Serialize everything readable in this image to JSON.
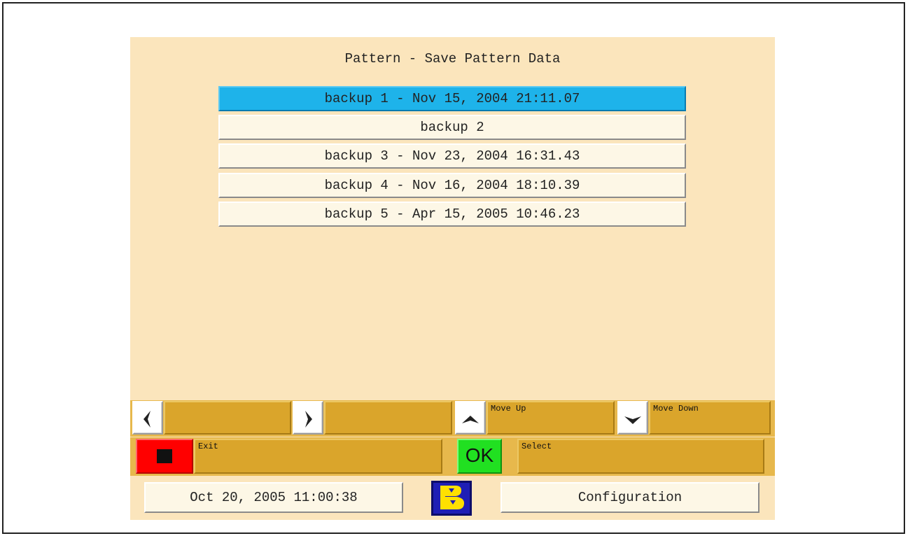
{
  "screen": {
    "title": "Pattern - Save Pattern Data"
  },
  "backups": [
    {
      "label": "backup 1 - Nov 15, 2004 21:11.07",
      "selected": true
    },
    {
      "label": "backup 2",
      "selected": false
    },
    {
      "label": "backup 3 - Nov 23, 2004 16:31.43",
      "selected": false
    },
    {
      "label": "backup 4 - Nov 16, 2004 18:10.39",
      "selected": false
    },
    {
      "label": "backup 5 - Apr 15, 2005 10:46.23",
      "selected": false
    }
  ],
  "softkeys": {
    "left": {
      "icon": "arrow-left-icon",
      "label": ""
    },
    "right": {
      "icon": "arrow-right-icon",
      "label": ""
    },
    "up": {
      "icon": "arrow-up-icon",
      "label": "Move Up"
    },
    "down": {
      "icon": "arrow-down-icon",
      "label": "Move Down"
    },
    "exit": {
      "icon": "stop-icon",
      "label": "Exit"
    },
    "ok": {
      "icon_text": "OK",
      "label": "Select"
    }
  },
  "status": {
    "datetime": "Oct 20, 2005 11:00:38",
    "configuration": "Configuration",
    "logo_icon": "brand-logo-icon"
  },
  "colors": {
    "background": "#fbe5bc",
    "selected": "#1eb3ea",
    "softkey": "#daa52b",
    "exit_red": "#ff0000",
    "ok_green": "#21e021",
    "logo_blue": "#1f1fb5",
    "logo_yellow": "#ffe000"
  }
}
